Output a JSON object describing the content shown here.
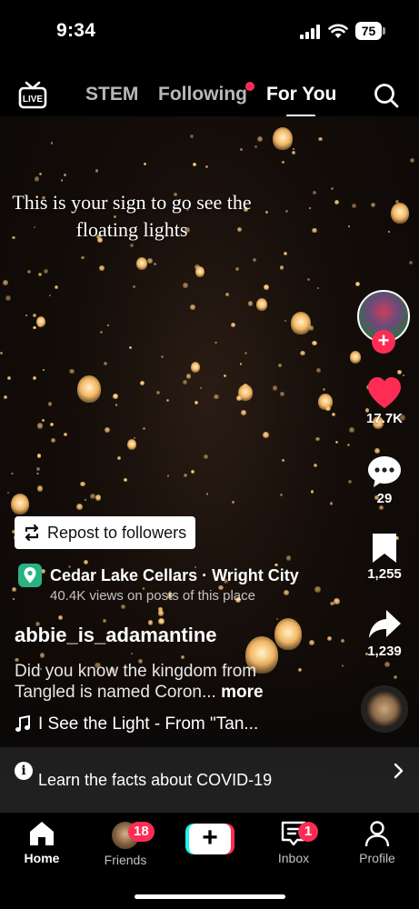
{
  "status_bar": {
    "time": "9:34",
    "battery": "75"
  },
  "top_nav": {
    "live_label": "LIVE",
    "tabs": [
      "STEM",
      "Following",
      "For You"
    ],
    "active_tab": "For You"
  },
  "video": {
    "caption_line1": "This is your sign to go see the",
    "caption_line2": "floating lights"
  },
  "rail": {
    "likes": "17.7K",
    "comments": "29",
    "saves": "1,255",
    "shares": "1,239"
  },
  "post": {
    "repost_label": "Repost to followers",
    "place_name": "Cedar Lake Cellars · Wright City",
    "place_views": "40.4K views on posts of this place",
    "username": "abbie_is_adamantine",
    "description_line1": "Did you know the kingdom from",
    "description_line2": "Tangled is named Coron...",
    "more_label": "more",
    "song": "I See the Light - From \"Tan..."
  },
  "banner": {
    "text": "Learn the facts about COVID-19"
  },
  "tabbar": {
    "home": "Home",
    "friends": "Friends",
    "friends_badge": "18",
    "inbox": "Inbox",
    "inbox_badge": "1",
    "profile": "Profile",
    "create_symbol": "+"
  },
  "colors": {
    "accent": "#fe2c55",
    "teal": "#25f4ee",
    "place_pin": "#27b383"
  },
  "icons": [
    "live-icon",
    "search-icon",
    "heart-icon",
    "comment-icon",
    "bookmark-icon",
    "share-icon",
    "repost-icon",
    "location-pin-icon",
    "music-note-icon",
    "info-icon",
    "chevron-right-icon",
    "home-icon",
    "inbox-icon",
    "profile-icon"
  ]
}
